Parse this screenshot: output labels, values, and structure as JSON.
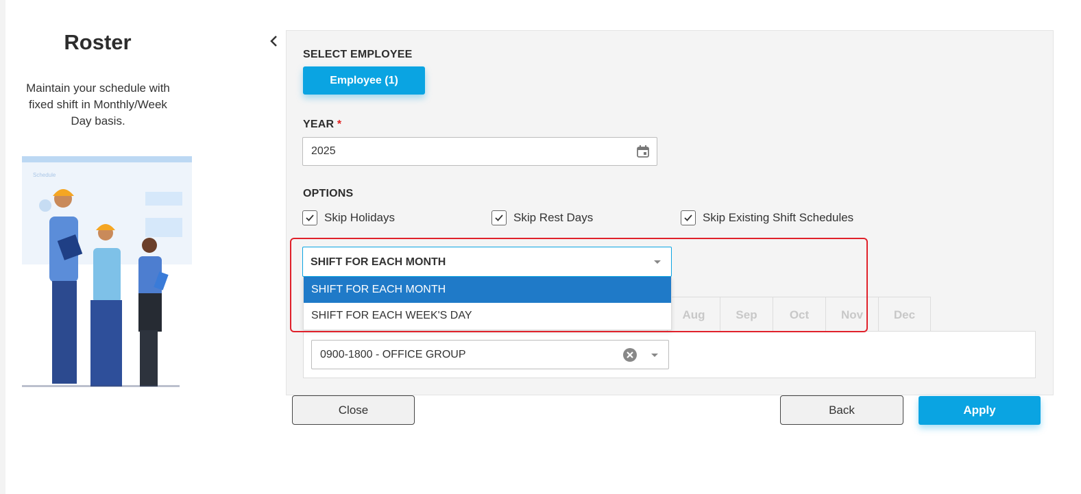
{
  "info": {
    "title": "Roster",
    "description": "Maintain your schedule with fixed shift in Monthly/Week Day basis.",
    "illustration_caption": "Schedule"
  },
  "select_employee": {
    "label": "SELECT EMPLOYEE",
    "button_label": "Employee (1)"
  },
  "year": {
    "label": "YEAR",
    "required_mark": "*",
    "value": "2025"
  },
  "options": {
    "label": "OPTIONS",
    "checkboxes": [
      {
        "label": "Skip Holidays",
        "checked": true
      },
      {
        "label": "Skip Rest Days",
        "checked": true
      },
      {
        "label": "Skip Existing Shift Schedules",
        "checked": true
      }
    ]
  },
  "mode_dropdown": {
    "selected": "SHIFT FOR EACH MONTH",
    "options": [
      "SHIFT FOR EACH MONTH",
      "SHIFT FOR EACH WEEK'S DAY"
    ]
  },
  "months": [
    "Aug",
    "Sep",
    "Oct",
    "Nov",
    "Dec"
  ],
  "shift": {
    "value": "0900-1800 - OFFICE GROUP"
  },
  "footer": {
    "close_label": "Close",
    "back_label": "Back",
    "apply_label": "Apply"
  },
  "colors": {
    "accent": "#0aa4e2",
    "selected_option": "#1f7ac8",
    "highlight": "#e0202a"
  }
}
